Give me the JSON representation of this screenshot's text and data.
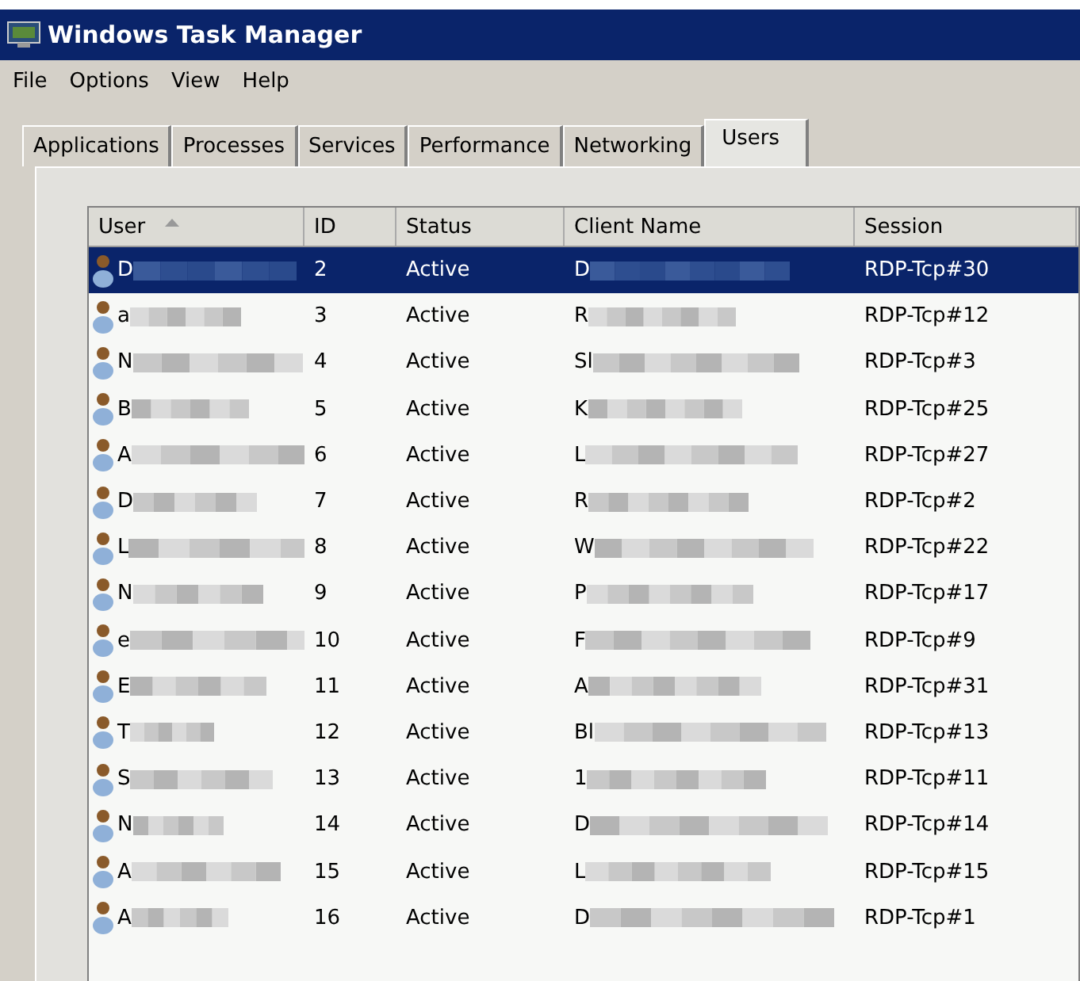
{
  "window": {
    "title": "Windows Task Manager"
  },
  "menu": [
    "File",
    "Options",
    "View",
    "Help"
  ],
  "tabs": [
    {
      "label": "Applications",
      "selected": false
    },
    {
      "label": "Processes",
      "selected": false
    },
    {
      "label": "Services",
      "selected": false
    },
    {
      "label": "Performance",
      "selected": false
    },
    {
      "label": "Networking",
      "selected": false
    },
    {
      "label": "Users",
      "selected": true
    }
  ],
  "table": {
    "columns": [
      {
        "label": "User",
        "sorted": true
      },
      {
        "label": "ID",
        "sorted": false
      },
      {
        "label": "Status",
        "sorted": false
      },
      {
        "label": "Client Name",
        "sorted": false
      },
      {
        "label": "Session",
        "sorted": false
      }
    ],
    "rows": [
      {
        "user": "D",
        "id": "2",
        "status": "Active",
        "client": "D",
        "session": "RDP-Tcp#30",
        "selected": true
      },
      {
        "user": "a",
        "id": "3",
        "status": "Active",
        "client": "R",
        "session": "RDP-Tcp#12",
        "selected": false
      },
      {
        "user": "N",
        "id": "4",
        "status": "Active",
        "client": "Sl",
        "session": "RDP-Tcp#3",
        "selected": false
      },
      {
        "user": "B",
        "id": "5",
        "status": "Active",
        "client": "K",
        "session": "RDP-Tcp#25",
        "selected": false
      },
      {
        "user": "A",
        "id": "6",
        "status": "Active",
        "client": "L",
        "session": "RDP-Tcp#27",
        "selected": false
      },
      {
        "user": "D",
        "id": "7",
        "status": "Active",
        "client": "R",
        "session": "RDP-Tcp#2",
        "selected": false
      },
      {
        "user": "L",
        "id": "8",
        "status": "Active",
        "client": "W",
        "session": "RDP-Tcp#22",
        "selected": false
      },
      {
        "user": "N",
        "id": "9",
        "status": "Active",
        "client": "P",
        "session": "RDP-Tcp#17",
        "selected": false
      },
      {
        "user": "e",
        "id": "10",
        "status": "Active",
        "client": "F",
        "session": "RDP-Tcp#9",
        "selected": false
      },
      {
        "user": "E",
        "id": "11",
        "status": "Active",
        "client": "A",
        "session": "RDP-Tcp#31",
        "selected": false
      },
      {
        "user": "T",
        "id": "12",
        "status": "Active",
        "client": "Bl",
        "session": "RDP-Tcp#13",
        "selected": false
      },
      {
        "user": "S",
        "id": "13",
        "status": "Active",
        "client": "1",
        "session": "RDP-Tcp#11",
        "selected": false
      },
      {
        "user": "N",
        "id": "14",
        "status": "Active",
        "client": "D",
        "session": "RDP-Tcp#14",
        "selected": false
      },
      {
        "user": "A",
        "id": "15",
        "status": "Active",
        "client": "L",
        "session": "RDP-Tcp#15",
        "selected": false
      },
      {
        "user": "A",
        "id": "16",
        "status": "Active",
        "client": "D",
        "session": "RDP-Tcp#1",
        "selected": false
      }
    ]
  }
}
